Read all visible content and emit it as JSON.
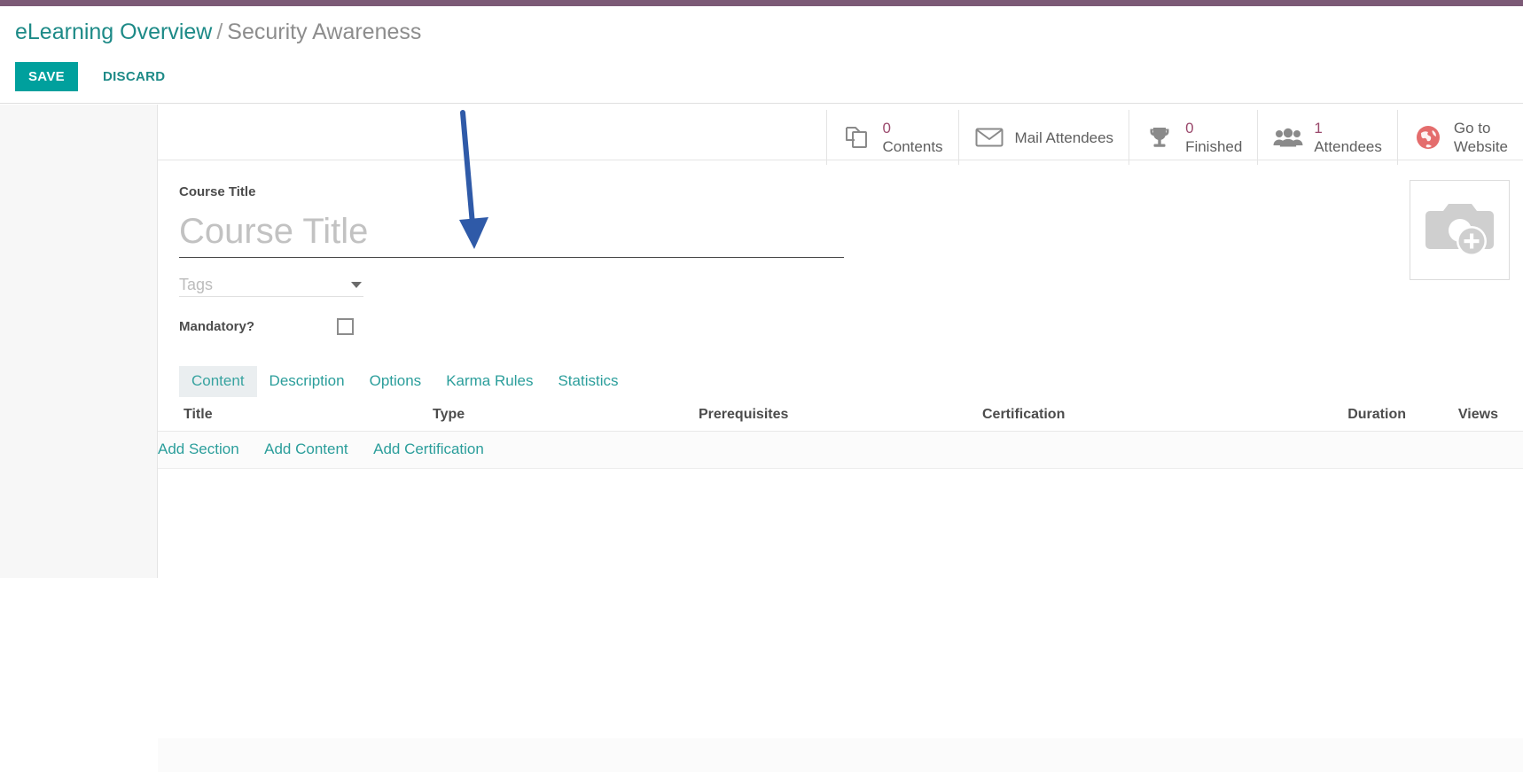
{
  "colors": {
    "navbar": "#7c5a76",
    "primary": "#00a09d",
    "link": "#2b9e9b",
    "stat_value": "#9b4a6d",
    "website_icon": "#e46d6d",
    "annotation_arrow": "#2f5aa8"
  },
  "breadcrumb": {
    "parent": "eLearning Overview",
    "separator": "/",
    "current": "Security Awareness"
  },
  "actions": {
    "save_label": "SAVE",
    "discard_label": "DISCARD"
  },
  "stat_buttons": [
    {
      "icon": "contents-icon",
      "value": "0",
      "label": "Contents",
      "has_value": true
    },
    {
      "icon": "envelope-icon",
      "value": "",
      "label": "Mail Attendees",
      "has_value": false
    },
    {
      "icon": "trophy-icon",
      "value": "0",
      "label": "Finished",
      "has_value": true
    },
    {
      "icon": "people-icon",
      "value": "1",
      "label": "Attendees",
      "has_value": true
    },
    {
      "icon": "globe-icon",
      "value": "",
      "label": "Go to\nWebsite",
      "has_value": false
    }
  ],
  "form": {
    "title_label": "Course Title",
    "title_value": "",
    "title_placeholder": "Course Title",
    "tags_value": "",
    "tags_placeholder": "Tags",
    "mandatory_label": "Mandatory?",
    "mandatory_checked": false,
    "image_icon": "camera-add-icon"
  },
  "notebook": {
    "tabs": [
      {
        "label": "Content",
        "active": true
      },
      {
        "label": "Description",
        "active": false
      },
      {
        "label": "Options",
        "active": false
      },
      {
        "label": "Karma Rules",
        "active": false
      },
      {
        "label": "Statistics",
        "active": false
      }
    ],
    "columns": [
      "Title",
      "Type",
      "Prerequisites",
      "Certification",
      "Duration",
      "Views"
    ],
    "rows": [],
    "add_links": [
      "Add Section",
      "Add Content",
      "Add Certification"
    ]
  }
}
